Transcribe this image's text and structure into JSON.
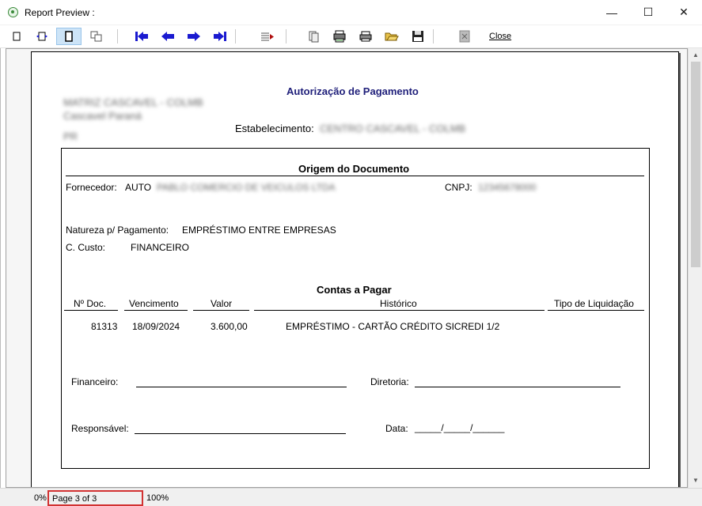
{
  "window": {
    "title": "Report Preview :",
    "minimize_glyph": "—",
    "maximize_glyph": "☐",
    "close_glyph": "✕"
  },
  "toolbar": {
    "close_label": "Close",
    "icons": [
      "single-page-icon",
      "page-width-icon",
      "full-page-icon",
      "multiple-pages-icon",
      "first-page-icon",
      "previous-page-icon",
      "next-page-icon",
      "last-page-icon",
      "goto-page-icon",
      "copy-icon",
      "print-setup-icon",
      "print-icon",
      "open-icon",
      "save-icon",
      "close-preview-icon"
    ]
  },
  "report": {
    "title": "Autorização de Pagamento",
    "company_lines": [
      "MATRIZ CASCAVEL - COLMB",
      "Cascavel Paraná",
      "PR"
    ],
    "establishment_label": "Estabelecimento:",
    "establishment_value": "CENTRO CASCAVEL - COLMB",
    "origin_header": "Origem do Documento",
    "supplier_label": "Fornecedor:",
    "supplier_prefix": "AUTO",
    "supplier_value": "PABLO COMERCIO DE VEICULOS LTDA",
    "cnpj_label": "CNPJ:",
    "cnpj_value": "12345678000",
    "payment_nature_label": "Natureza p/ Pagamento:",
    "payment_nature_value": "EMPRÉSTIMO ENTRE EMPRESAS",
    "cost_center_label": "C. Custo:",
    "cost_center_value": "FINANCEIRO",
    "payables_header": "Contas a Pagar",
    "columns": {
      "doc_no": "Nº Doc.",
      "due_date": "Vencimento",
      "value": "Valor",
      "history": "Histórico",
      "settlement_type": "Tipo de Liquidação"
    },
    "rows": [
      {
        "doc_no": "81313",
        "due_date": "18/09/2024",
        "value": "3.600,00",
        "history": "EMPRÉSTIMO - CARTÃO CRÉDITO SICREDI 1/2",
        "settlement_type": ""
      }
    ],
    "signatures": {
      "financial": "Financeiro:",
      "board": "Diretoria:",
      "responsible": "Responsável:",
      "date": "Data:",
      "date_blanks": "_____/_____/______"
    }
  },
  "statusbar": {
    "zoom_min": "0%",
    "page_indicator": "Page 3 of 3",
    "zoom_current": "100%"
  }
}
